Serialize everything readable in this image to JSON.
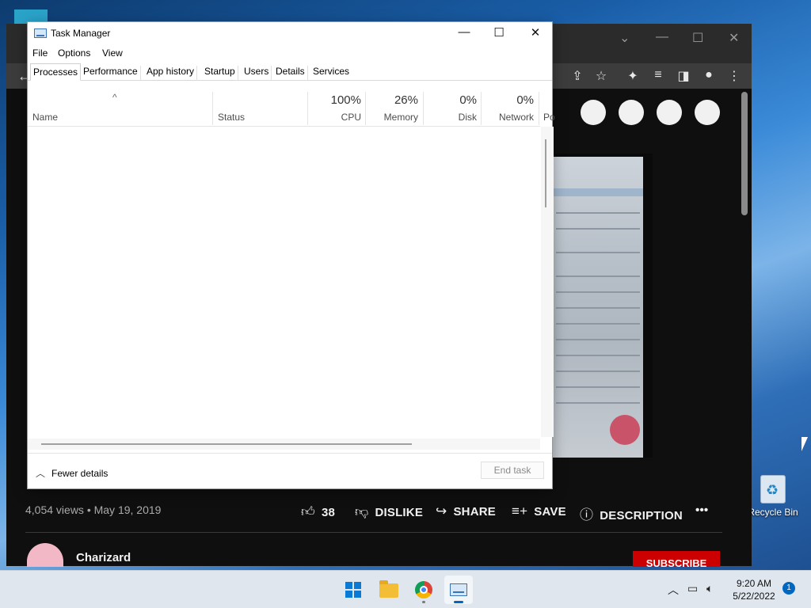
{
  "task_manager": {
    "title": "Task Manager",
    "menu": [
      "File",
      "Options",
      "View"
    ],
    "tabs": [
      "Processes",
      "Performance",
      "App history",
      "Startup",
      "Users",
      "Details",
      "Services"
    ],
    "active_tab": "Processes",
    "columns": {
      "name": "Name",
      "status": "Status",
      "cpu": {
        "pct": "100%",
        "label": "CPU"
      },
      "memory": {
        "pct": "26%",
        "label": "Memory"
      },
      "disk": {
        "pct": "0%",
        "label": "Disk"
      },
      "network": {
        "pct": "0%",
        "label": "Network"
      },
      "power_partial": "Po"
    },
    "fewer_details": "Fewer details",
    "end_task": "End task"
  },
  "youtube": {
    "views_date": "4,054 views • May 19, 2019",
    "like_count": "38",
    "dislike": "DISLIKE",
    "share": "SHARE",
    "save": "SAVE",
    "description": "DESCRIPTION",
    "more": "•••",
    "channel_name": "Charizard",
    "subscribe": "SUBSCRIBE"
  },
  "desktop": {
    "recycle_bin_label": "Recycle Bin"
  },
  "taskbar": {
    "time": "9:20 AM",
    "date": "5/22/2022",
    "notification_count": "1"
  },
  "colors": {
    "accent": "#0067c0",
    "subscribe_red": "#cc0000",
    "yt_background": "#0f0f0f"
  }
}
